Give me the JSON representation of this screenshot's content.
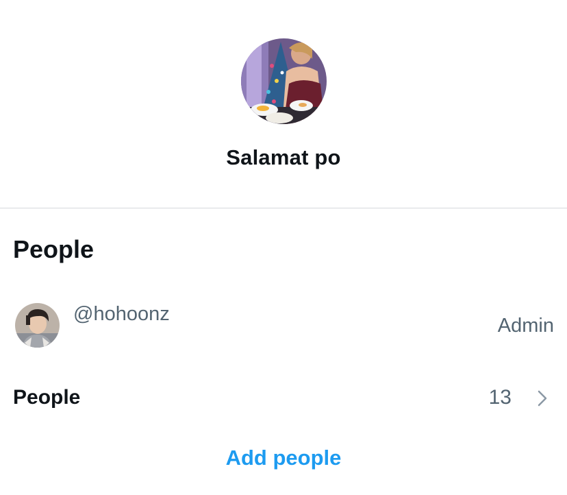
{
  "group": {
    "name": "Salamat po",
    "avatar_icon": "group-photo-avatar"
  },
  "people_section": {
    "title": "People",
    "members": [
      {
        "handle": "@hohoonz",
        "role": "Admin",
        "avatar_icon": "user-photo-avatar"
      }
    ],
    "people_row": {
      "label": "People",
      "count": "13",
      "icon": "chevron-right-icon"
    },
    "add_people_label": "Add people"
  },
  "colors": {
    "primary_text": "#0f1419",
    "secondary_text": "#536471",
    "accent": "#1d9bf0",
    "divider": "#d6d9dc"
  }
}
